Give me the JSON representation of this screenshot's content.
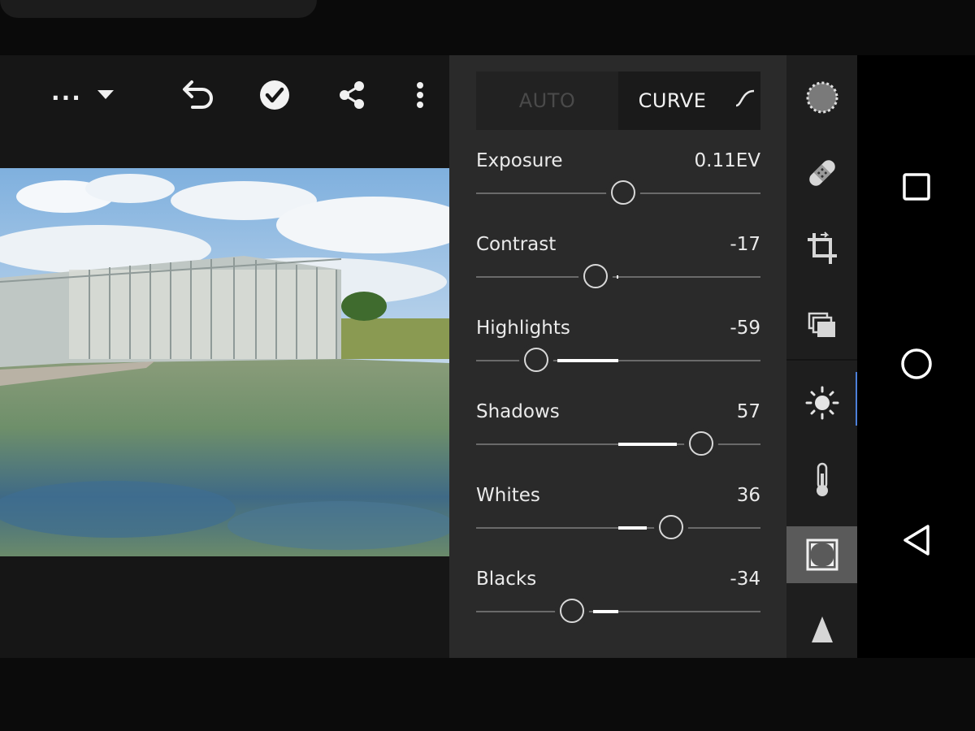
{
  "toolbar": {
    "ellipsis_label": "...",
    "icons": [
      "dropdown-caret-icon",
      "undo-icon",
      "checkmark-icon",
      "share-icon",
      "more-vert-icon"
    ]
  },
  "panel": {
    "segments": {
      "auto": "AUTO",
      "curve": "CURVE",
      "active": "CURVE"
    },
    "sliders": [
      {
        "name": "Exposure",
        "value": "0.11EV",
        "fraction": 0.51
      },
      {
        "name": "Contrast",
        "value": "-17",
        "fraction": 0.415
      },
      {
        "name": "Highlights",
        "value": "-59",
        "fraction": 0.205
      },
      {
        "name": "Shadows",
        "value": "57",
        "fraction": 0.785
      },
      {
        "name": "Whites",
        "value": "36",
        "fraction": 0.68
      },
      {
        "name": "Blacks",
        "value": "-34",
        "fraction": 0.33
      }
    ]
  },
  "tool_rail": {
    "icons": [
      "selective-adjust-icon",
      "healing-brush-icon",
      "crop-icon",
      "presets-icon",
      "light-icon",
      "color-temperature-icon",
      "vignette-effects-icon",
      "detail-icon"
    ],
    "selected": "vignette-effects-icon",
    "accent_color": "#4d7fd9"
  },
  "system_nav": {
    "icons": [
      "recents-square-icon",
      "home-circle-icon",
      "back-triangle-icon"
    ]
  }
}
